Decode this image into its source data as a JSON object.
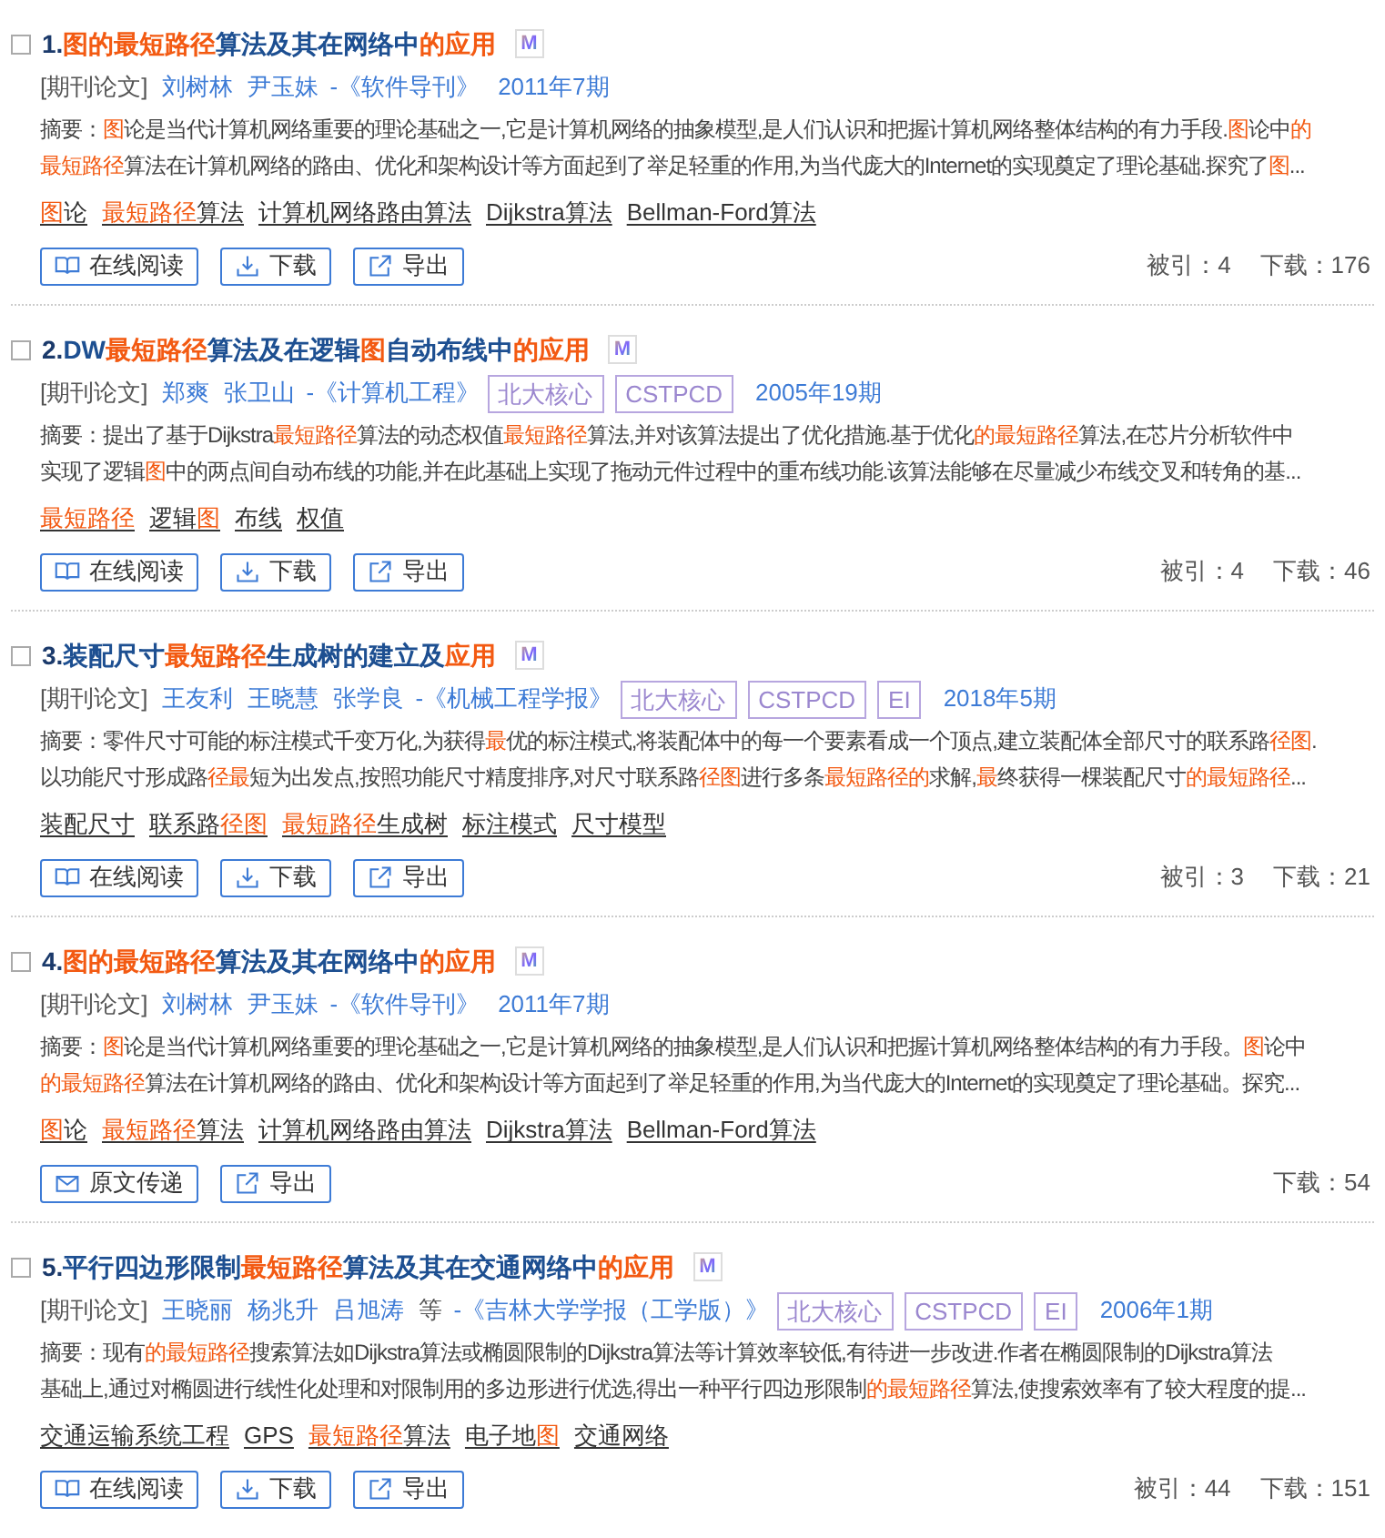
{
  "results": [
    {
      "checked": false,
      "number": "1.",
      "title": [
        {
          "text": "图的最短路径",
          "highlight": true
        },
        {
          "text": "算法及其在网络中",
          "highlight": false
        },
        {
          "text": "的应用",
          "highlight": true
        }
      ],
      "format_badge": "M",
      "type_label": "[期刊论文]",
      "authors": [
        "刘树林",
        "尹玉妹"
      ],
      "journal": "-《软件导刊》",
      "date": "2011年7期",
      "abstract": [
        [
          {
            "text": "摘要：",
            "highlight": false
          },
          {
            "text": "图",
            "highlight": true
          },
          {
            "text": "论是当代计算机网络重要的理论基础之一,它是计算机网络的抽象模型,是人们认识和把握计算机网络整体结构的有力手段.",
            "highlight": false
          },
          {
            "text": "图",
            "highlight": true
          },
          {
            "text": "论中",
            "highlight": false
          },
          {
            "text": "的",
            "highlight": true
          }
        ],
        [
          {
            "text": "最短路径",
            "highlight": true
          },
          {
            "text": "算法在计算机网络的路由、优化和架构设计等方面起到了举足轻重的作用,为当代庞大的Internet的实现奠定了理论基础.探究了",
            "highlight": false
          },
          {
            "text": "图",
            "highlight": true
          },
          {
            "text": "...",
            "highlight": false
          }
        ]
      ],
      "keywords": [
        [
          {
            "text": "图",
            "highlight": true
          },
          {
            "text": "论",
            "highlight": false
          }
        ],
        [
          {
            "text": "最短路径",
            "highlight": true
          },
          {
            "text": "算法",
            "highlight": false
          }
        ],
        [
          {
            "text": "计算机网络路由算法",
            "highlight": false
          }
        ],
        [
          {
            "text": "Dijkstra算法",
            "highlight": false
          }
        ],
        [
          {
            "text": "Bellman-Ford算法",
            "highlight": false
          }
        ]
      ],
      "actions": [
        {
          "kind": "read",
          "label": "在线阅读"
        },
        {
          "kind": "download",
          "label": "下载"
        },
        {
          "kind": "export",
          "label": "导出"
        }
      ],
      "stats": [
        "被引：4",
        "下载：176"
      ]
    },
    {
      "checked": false,
      "number": "2.",
      "title": [
        {
          "text": "DW",
          "highlight": false
        },
        {
          "text": "最短路径",
          "highlight": true
        },
        {
          "text": "算法及在逻辑",
          "highlight": false
        },
        {
          "text": "图",
          "highlight": true
        },
        {
          "text": "自动布线中",
          "highlight": false
        },
        {
          "text": "的应用",
          "highlight": true
        }
      ],
      "format_badge": "M",
      "type_label": "[期刊论文]",
      "authors": [
        "郑爽",
        "张卫山"
      ],
      "journal": "-《计算机工程》",
      "badges": [
        "北大核心",
        "CSTPCD"
      ],
      "date": "2005年19期",
      "abstract": [
        [
          {
            "text": "摘要：提出了基于Dijkstra",
            "highlight": false
          },
          {
            "text": "最短路径",
            "highlight": true
          },
          {
            "text": "算法的动态权值",
            "highlight": false
          },
          {
            "text": "最短路径",
            "highlight": true
          },
          {
            "text": "算法,并对该算法提出了优化措施.基于优化",
            "highlight": false
          },
          {
            "text": "的最短路径",
            "highlight": true
          },
          {
            "text": "算法,在芯片分析软件中",
            "highlight": false
          }
        ],
        [
          {
            "text": "实现了逻辑",
            "highlight": false
          },
          {
            "text": "图",
            "highlight": true
          },
          {
            "text": "中的两点间自动布线的功能,并在此基础上实现了拖动元件过程中的重布线功能.该算法能够在尽量减少布线交叉和转角的基...",
            "highlight": false
          }
        ]
      ],
      "keywords": [
        [
          {
            "text": "最短路径",
            "highlight": true
          }
        ],
        [
          {
            "text": "逻辑",
            "highlight": false
          },
          {
            "text": "图",
            "highlight": true
          }
        ],
        [
          {
            "text": "布线",
            "highlight": false
          }
        ],
        [
          {
            "text": "权值",
            "highlight": false
          }
        ]
      ],
      "actions": [
        {
          "kind": "read",
          "label": "在线阅读"
        },
        {
          "kind": "download",
          "label": "下载"
        },
        {
          "kind": "export",
          "label": "导出"
        }
      ],
      "stats": [
        "被引：4",
        "下载：46"
      ]
    },
    {
      "checked": false,
      "number": "3.",
      "title": [
        {
          "text": "装配尺寸",
          "highlight": false
        },
        {
          "text": "最短路径",
          "highlight": true
        },
        {
          "text": "生成树的建立及",
          "highlight": false
        },
        {
          "text": "应用",
          "highlight": true
        }
      ],
      "format_badge": "M",
      "type_label": "[期刊论文]",
      "authors": [
        "王友利",
        "王晓慧",
        "张学良"
      ],
      "journal": "-《机械工程学报》",
      "badges": [
        "北大核心",
        "CSTPCD",
        "EI"
      ],
      "date": "2018年5期",
      "abstract": [
        [
          {
            "text": "摘要：零件尺寸可能的标注模式千变万化,为获得",
            "highlight": false
          },
          {
            "text": "最",
            "highlight": true
          },
          {
            "text": "优的标注模式,将装配体中的每一个要素看成一个顶点,建立装配体全部尺寸的联系路",
            "highlight": false
          },
          {
            "text": "径图",
            "highlight": true
          },
          {
            "text": ".",
            "highlight": false
          }
        ],
        [
          {
            "text": "以功能尺寸形成路",
            "highlight": false
          },
          {
            "text": "径最",
            "highlight": true
          },
          {
            "text": "短为出发点,按照功能尺寸精度排序,对尺寸联系路",
            "highlight": false
          },
          {
            "text": "径图",
            "highlight": true
          },
          {
            "text": "进行多条",
            "highlight": false
          },
          {
            "text": "最短路径的",
            "highlight": true
          },
          {
            "text": "求解,",
            "highlight": false
          },
          {
            "text": "最",
            "highlight": true
          },
          {
            "text": "终获得一棵装配尺寸",
            "highlight": false
          },
          {
            "text": "的最短路径",
            "highlight": true
          },
          {
            "text": "...",
            "highlight": false
          }
        ]
      ],
      "keywords": [
        [
          {
            "text": "装配尺寸",
            "highlight": false
          }
        ],
        [
          {
            "text": "联系路",
            "highlight": false
          },
          {
            "text": "径图",
            "highlight": true
          }
        ],
        [
          {
            "text": "最短路径",
            "highlight": true
          },
          {
            "text": "生成树",
            "highlight": false
          }
        ],
        [
          {
            "text": "标注模式",
            "highlight": false
          }
        ],
        [
          {
            "text": "尺寸模型",
            "highlight": false
          }
        ]
      ],
      "actions": [
        {
          "kind": "read",
          "label": "在线阅读"
        },
        {
          "kind": "download",
          "label": "下载"
        },
        {
          "kind": "export",
          "label": "导出"
        }
      ],
      "stats": [
        "被引：3",
        "下载：21"
      ]
    },
    {
      "checked": false,
      "number": "4.",
      "title": [
        {
          "text": "图的最短路径",
          "highlight": true
        },
        {
          "text": "算法及其在网络中",
          "highlight": false
        },
        {
          "text": "的应用",
          "highlight": true
        }
      ],
      "format_badge": "M",
      "type_label": "[期刊论文]",
      "authors": [
        "刘树林",
        "尹玉妹"
      ],
      "journal": "-《软件导刊》",
      "date": "2011年7期",
      "abstract": [
        [
          {
            "text": "摘要：",
            "highlight": false
          },
          {
            "text": "图",
            "highlight": true
          },
          {
            "text": "论是当代计算机网络重要的理论基础之一,它是计算机网络的抽象模型,是人们认识和把握计算机网络整体结构的有力手段。",
            "highlight": false
          },
          {
            "text": "图",
            "highlight": true
          },
          {
            "text": "论中",
            "highlight": false
          }
        ],
        [
          {
            "text": "的最短路径",
            "highlight": true
          },
          {
            "text": "算法在计算机网络的路由、优化和架构设计等方面起到了举足轻重的作用,为当代庞大的Internet的实现奠定了理论基础。探究...",
            "highlight": false
          }
        ]
      ],
      "keywords": [
        [
          {
            "text": "图",
            "highlight": true
          },
          {
            "text": "论",
            "highlight": false
          }
        ],
        [
          {
            "text": "最短路径",
            "highlight": true
          },
          {
            "text": "算法",
            "highlight": false
          }
        ],
        [
          {
            "text": "计算机网络路由算法",
            "highlight": false
          }
        ],
        [
          {
            "text": "Dijkstra算法",
            "highlight": false
          }
        ],
        [
          {
            "text": "Bellman-Ford算法",
            "highlight": false
          }
        ]
      ],
      "actions": [
        {
          "kind": "deliver",
          "label": "原文传递"
        },
        {
          "kind": "export",
          "label": "导出"
        }
      ],
      "stats": [
        "下载：54"
      ]
    },
    {
      "checked": false,
      "number": "5.",
      "title": [
        {
          "text": "平行四边形限制",
          "highlight": false
        },
        {
          "text": "最短路径",
          "highlight": true
        },
        {
          "text": "算法及其在交通网络中",
          "highlight": false
        },
        {
          "text": "的应用",
          "highlight": true
        }
      ],
      "format_badge": "M",
      "type_label": "[期刊论文]",
      "authors": [
        "王晓丽",
        "杨兆升",
        "吕旭涛"
      ],
      "authors_more": "等",
      "journal": "-《吉林大学学报（工学版）》",
      "badges": [
        "北大核心",
        "CSTPCD",
        "EI"
      ],
      "date": "2006年1期",
      "abstract": [
        [
          {
            "text": "摘要：现有",
            "highlight": false
          },
          {
            "text": "的最短路径",
            "highlight": true
          },
          {
            "text": "搜索算法如Dijkstra算法或椭圆限制的Dijkstra算法等计算效率较低,有待进一步改进.作者在椭圆限制的Dijkstra算法",
            "highlight": false
          }
        ],
        [
          {
            "text": "基础上,通过对椭圆进行线性化处理和对限制用的多边形进行优选,得出一种平行四边形限制",
            "highlight": false
          },
          {
            "text": "的最短路径",
            "highlight": true
          },
          {
            "text": "算法,使搜索效率有了较大程度的提...",
            "highlight": false
          }
        ]
      ],
      "keywords": [
        [
          {
            "text": "交通运输系统工程",
            "highlight": false
          }
        ],
        [
          {
            "text": "GPS",
            "highlight": false
          }
        ],
        [
          {
            "text": "最短路径",
            "highlight": true
          },
          {
            "text": "算法",
            "highlight": false
          }
        ],
        [
          {
            "text": "电子地",
            "highlight": false
          },
          {
            "text": "图",
            "highlight": true
          }
        ],
        [
          {
            "text": "交通网络",
            "highlight": false
          }
        ]
      ],
      "actions": [
        {
          "kind": "read",
          "label": "在线阅读"
        },
        {
          "kind": "download",
          "label": "下载"
        },
        {
          "kind": "export",
          "label": "导出"
        }
      ],
      "stats": [
        "被引：44",
        "下载：151"
      ]
    }
  ]
}
